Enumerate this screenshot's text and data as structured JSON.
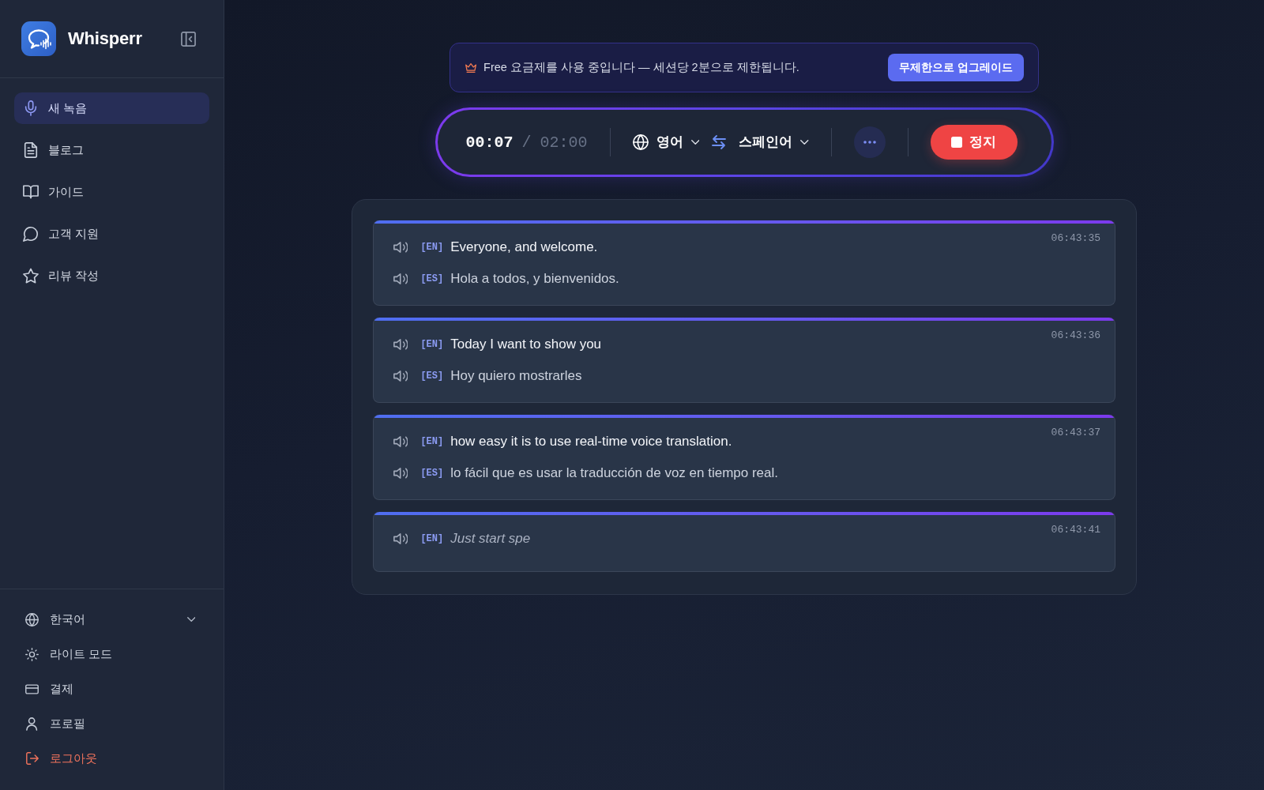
{
  "sidebar": {
    "brand": "Whisperr",
    "nav": [
      {
        "label": "새 녹음",
        "selected": true
      },
      {
        "label": "블로그",
        "selected": false
      },
      {
        "label": "가이드",
        "selected": false
      },
      {
        "label": "고객 지원",
        "selected": false
      },
      {
        "label": "리뷰 작성",
        "selected": false
      }
    ],
    "footer": [
      {
        "label": "한국어",
        "kind": "dropdown"
      },
      {
        "label": "라이트 모드",
        "kind": "link"
      },
      {
        "label": "결제",
        "kind": "link"
      },
      {
        "label": "프로필",
        "kind": "link"
      },
      {
        "label": "로그아웃",
        "kind": "danger"
      }
    ]
  },
  "plan_banner": {
    "text": "Free 요금제를 사용 중입니다 — 세션당 2분으로 제한됩니다.",
    "button": "무제한으로 업그레이드"
  },
  "recorder": {
    "elapsed": "00:07",
    "separator": "/",
    "limit": "02:00",
    "source_language": "영어",
    "target_language": "스페인어",
    "stop_button": "정지"
  },
  "transcript": [
    {
      "time": "06:43:35",
      "interim": false,
      "lines": [
        {
          "tag": "[EN]",
          "text": "Everyone, and welcome."
        },
        {
          "tag": "[ES]",
          "text": "Hola a todos, y bienvenidos."
        }
      ]
    },
    {
      "time": "06:43:36",
      "interim": false,
      "lines": [
        {
          "tag": "[EN]",
          "text": "Today I want to show you"
        },
        {
          "tag": "[ES]",
          "text": "Hoy quiero mostrarles"
        }
      ]
    },
    {
      "time": "06:43:37",
      "interim": false,
      "lines": [
        {
          "tag": "[EN]",
          "text": "how easy it is to use real-time voice translation."
        },
        {
          "tag": "[ES]",
          "text": "lo fácil que es usar la traducción de voz en tiempo real."
        }
      ]
    },
    {
      "time": "06:43:41",
      "interim": true,
      "lines": [
        {
          "tag": "[EN]",
          "text": "Just start spe"
        }
      ]
    }
  ]
}
